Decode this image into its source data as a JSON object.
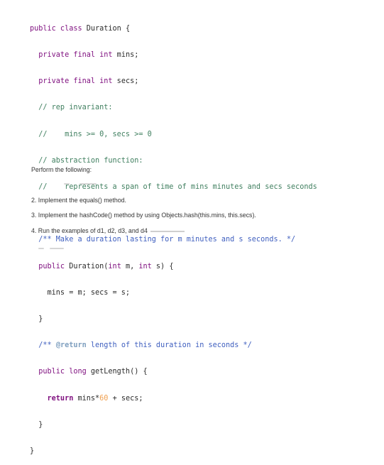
{
  "code": {
    "l1_a": "public class",
    "l1_b": " Duration {",
    "l2_a": "  private final int",
    "l2_b": " mins;",
    "l3_a": "  private final int",
    "l3_b": " secs;",
    "l4": "  // rep invariant:",
    "l5": "  //    mins >= 0, secs >= 0",
    "l6": "  // abstraction function:",
    "l7": "  //    represents a span of time of mins minutes and secs seconds",
    "l8": "  /** Make a duration lasting for m minutes and s seconds. */",
    "l9_a": "  public",
    "l9_b": " Duration(",
    "l9_c": "int",
    "l9_d": " m, ",
    "l9_e": "int",
    "l9_f": " s) {",
    "l10": "    mins = m; secs = s;",
    "l11": "  }",
    "l12_a": "  /** ",
    "l12_b": "@return",
    "l12_c": " length of this duration in seconds */",
    "l13_a": "  public long",
    "l13_b": " getLength() {",
    "l14_a": "    return",
    "l14_b": " mins*",
    "l14_c": "60",
    "l14_d": " + secs;",
    "l15": "  }",
    "l16": "}"
  },
  "instructions": {
    "heading": "Perform the following:",
    "item2": "2. Implement the equals() method.",
    "item3": "3. Implement the hashCode() method by using Objects.hash(this.mins, this.secs).",
    "item4": "4. Run the examples of d1, d2, d3, and d4"
  }
}
